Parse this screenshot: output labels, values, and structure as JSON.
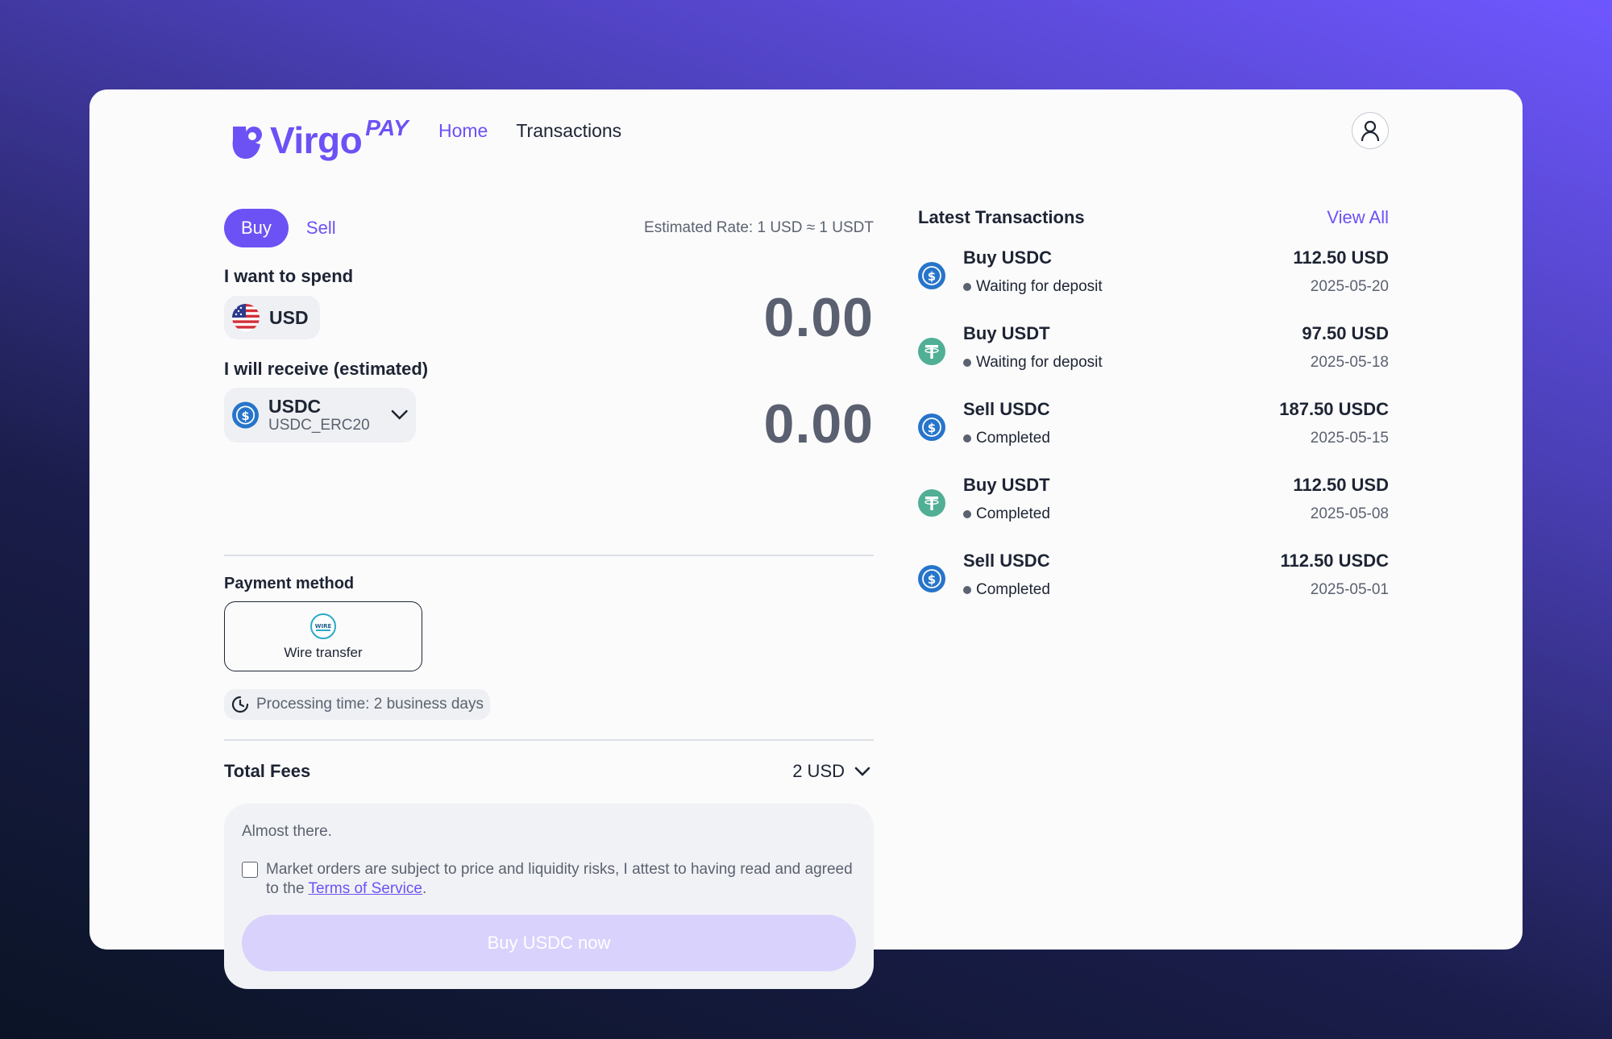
{
  "header": {
    "logo_word": "Virgo",
    "logo_pay": "PAY",
    "nav": {
      "home": "Home",
      "transactions": "Transactions"
    }
  },
  "trade": {
    "tab_buy": "Buy",
    "tab_sell": "Sell",
    "rate": "Estimated Rate: 1 USD ≈ 1 USDT",
    "spend_label": "I want to spend",
    "spend_currency": "USD",
    "spend_amount": "0.00",
    "receive_label": "I will receive (estimated)",
    "receive_currency": "USDC",
    "receive_network": "USDC_ERC20",
    "receive_amount": "0.00",
    "payment_method_label": "Payment method",
    "payment_method": "Wire transfer",
    "payment_badge_text": "WIRE",
    "processing_time": "Processing time: 2 business days",
    "fees_label": "Total Fees",
    "fees_value": "2 USD",
    "almost": "Almost there.",
    "terms_text": "Market orders are subject to price and liquidity risks, I attest to having read and agreed to the ",
    "terms_link": "Terms of Service",
    "terms_end": ".",
    "buy_button": "Buy USDC now"
  },
  "latest": {
    "title": "Latest Transactions",
    "view_all": "View All",
    "items": [
      {
        "name": "Buy USDC",
        "status": "Waiting for deposit",
        "amount": "112.50 USD",
        "date": "2025-05-20",
        "icon": "usdc-icon"
      },
      {
        "name": "Buy USDT",
        "status": "Waiting for deposit",
        "amount": "97.50 USD",
        "date": "2025-05-18",
        "icon": "usdt-icon"
      },
      {
        "name": "Sell USDC",
        "status": "Completed",
        "amount": "187.50 USDC",
        "date": "2025-05-15",
        "icon": "usdc-icon"
      },
      {
        "name": "Buy USDT",
        "status": "Completed",
        "amount": "112.50 USD",
        "date": "2025-05-08",
        "icon": "usdt-icon"
      },
      {
        "name": "Sell USDC",
        "status": "Completed",
        "amount": "112.50 USDC",
        "date": "2025-05-01",
        "icon": "usdc-icon"
      }
    ]
  },
  "colors": {
    "accent": "#6c52f5",
    "usdc": "#2775ca",
    "usdt": "#50af95"
  }
}
